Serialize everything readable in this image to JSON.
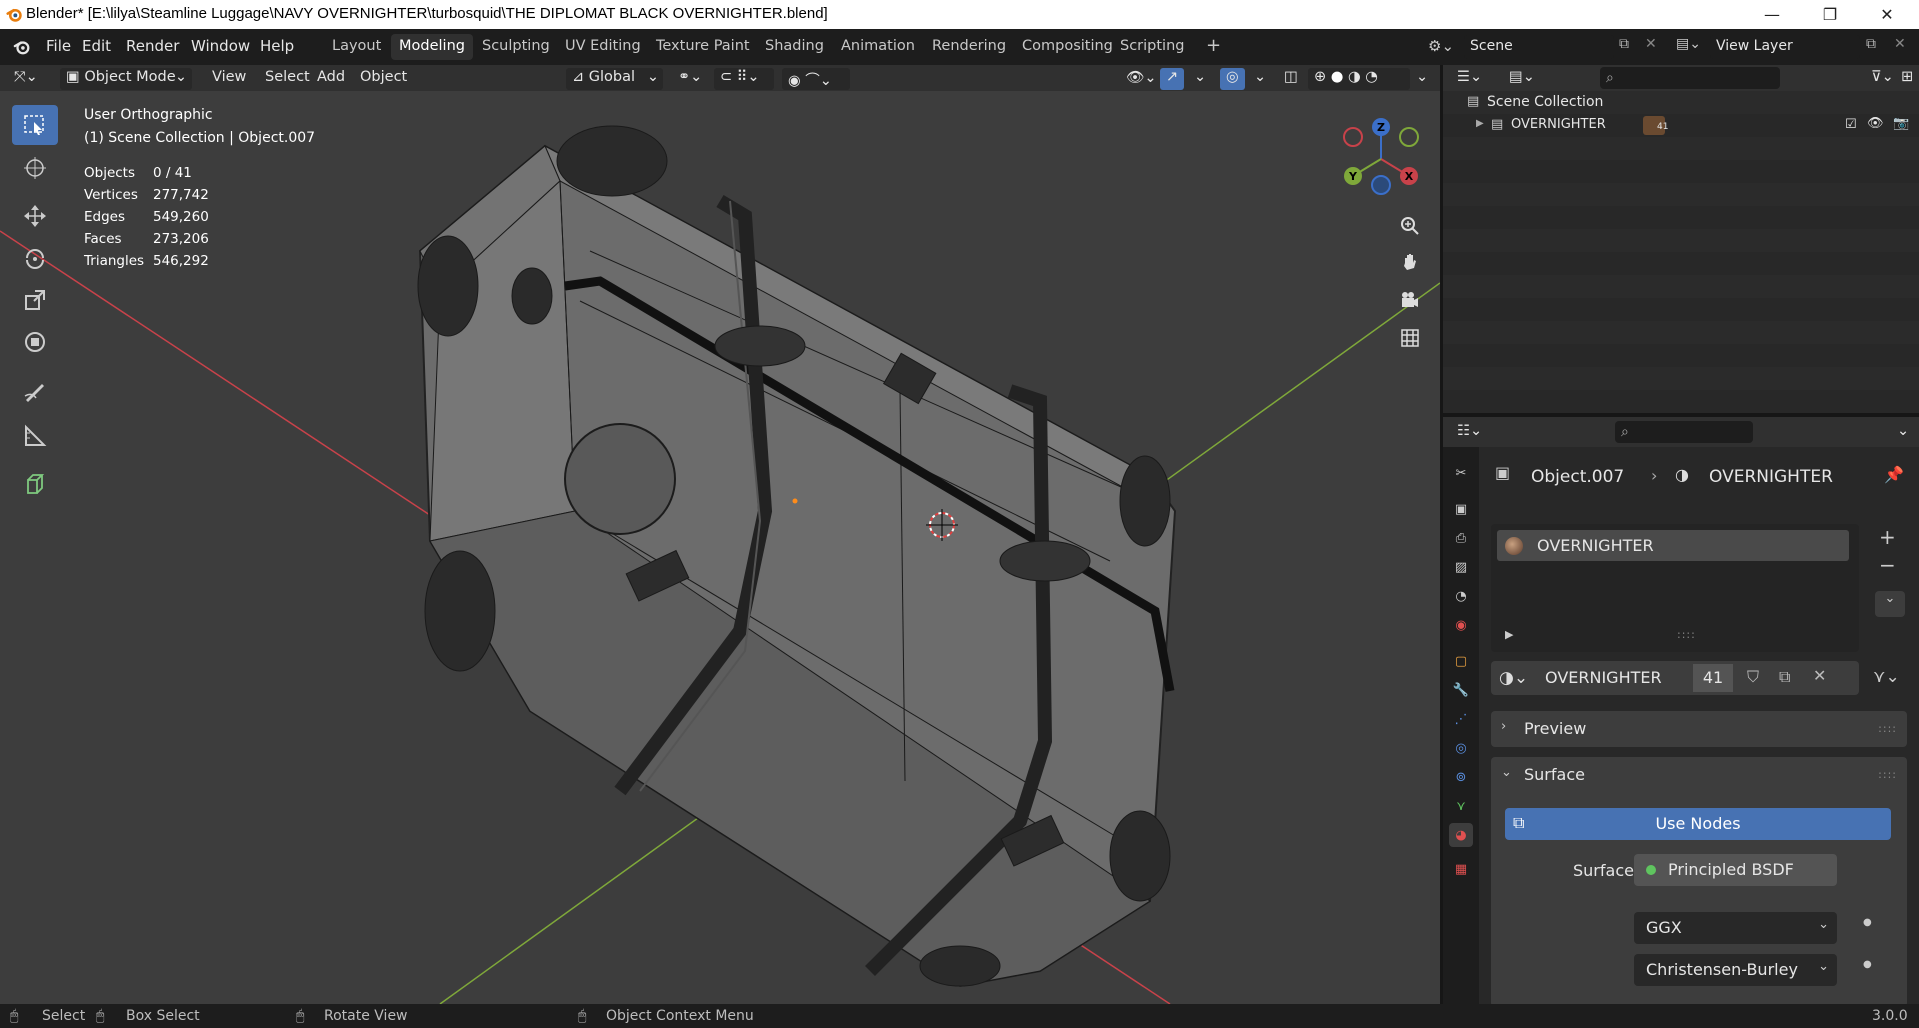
{
  "window": {
    "title": "Blender* [E:\\lilya\\Steamline Luggage\\NAVY OVERNIGHTER\\turbosquid\\THE DIPLOMAT BLACK OVERNIGHTER.blend]",
    "minimize": "—",
    "maximize": "❐",
    "close": "✕"
  },
  "menu": [
    "File",
    "Edit",
    "Render",
    "Window",
    "Help"
  ],
  "workspaces": [
    "Layout",
    "Modeling",
    "Sculpting",
    "UV Editing",
    "Texture Paint",
    "Shading",
    "Animation",
    "Rendering",
    "Compositing",
    "Scripting",
    "+"
  ],
  "active_workspace": "Modeling",
  "scene": {
    "name": "Scene",
    "view_layer": "View Layer"
  },
  "viewport_header": {
    "mode": "Object Mode",
    "menus": [
      "View",
      "Select",
      "Add",
      "Object"
    ],
    "transform_orientation": "Global"
  },
  "viewport_info": {
    "view_name": "User Orthographic",
    "collection": "(1) Scene Collection | Object.007",
    "stats": [
      {
        "label": "Objects",
        "value": "0 / 41"
      },
      {
        "label": "Vertices",
        "value": "277,742"
      },
      {
        "label": "Edges",
        "value": "549,260"
      },
      {
        "label": "Faces",
        "value": "273,206"
      },
      {
        "label": "Triangles",
        "value": "546,292"
      }
    ]
  },
  "gizmo": {
    "x": "X",
    "y": "Y",
    "z": "Z"
  },
  "tools": [
    "select-box-icon",
    "cursor-icon",
    "move-icon",
    "rotate-icon",
    "scale-icon",
    "transform-icon",
    "annotate-icon",
    "measure-icon",
    "add-cube-icon"
  ],
  "outliner": {
    "root": "Scene Collection",
    "items": [
      {
        "name": "OVERNIGHTER",
        "badge": "41"
      }
    ]
  },
  "properties": {
    "breadcrumb_object": "Object.007",
    "breadcrumb_material": "OVERNIGHTER",
    "slot_name": "OVERNIGHTER",
    "material_name": "OVERNIGHTER",
    "user_count": "41",
    "panels": {
      "preview": "Preview",
      "surface": "Surface"
    },
    "use_nodes": "Use Nodes",
    "surface_label": "Surface",
    "surface_value": "Principled BSDF",
    "distribution": "GGX",
    "subsurface_method": "Christensen-Burley",
    "slot_handle": "::::"
  },
  "statusbar": {
    "select": "Select",
    "box_select": "Box Select",
    "rotate_view": "Rotate View",
    "context_menu": "Object Context Menu",
    "version": "3.0.0"
  },
  "colors": {
    "accent": "#4772b3",
    "x_axis": "#c8424a",
    "y_axis": "#7fa83a",
    "z_axis": "#3b6fc9",
    "viewport_bg": "#3d3d3d",
    "surface_dot": "#5fc45f"
  }
}
